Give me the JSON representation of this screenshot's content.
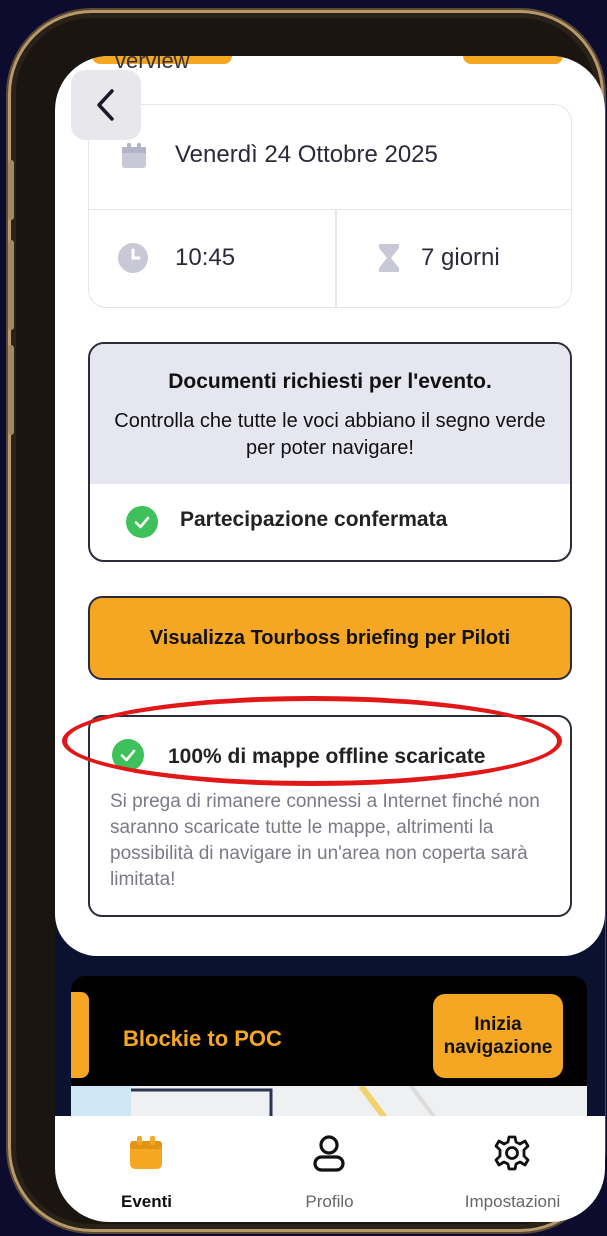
{
  "header": {
    "peek_text": "verview"
  },
  "event_info": {
    "date": "Venerdì 24 Ottobre 2025",
    "time": "10:45",
    "duration": "7 giorni"
  },
  "documents": {
    "title": "Documenti richiesti per l'evento.",
    "subtitle": "Controlla che tutte le voci abbiano il segno verde per poter navigare!",
    "items": [
      {
        "label": "Partecipazione confermata",
        "status": "check-icon"
      }
    ]
  },
  "briefing_button": {
    "label": "Visualizza Tourboss briefing per Piloti"
  },
  "offline_maps": {
    "title": "100% di mappe offline scaricate",
    "description": "Si prega di rimanere connessi a Internet finché non saranno scaricate tutte le mappe, altrimenti la possibilità di navigare in un'area non coperta sarà limitata!"
  },
  "event_bar": {
    "name": "Blockie to POC",
    "start_button": "Inizia navigazione"
  },
  "tabbar": {
    "tabs": [
      {
        "label": "Eventi",
        "icon": "calendar-icon",
        "active": true
      },
      {
        "label": "Profilo",
        "icon": "user-icon",
        "active": false
      },
      {
        "label": "Impostazioni",
        "icon": "gear-icon",
        "active": false
      }
    ]
  },
  "colors": {
    "accent": "#f5a623",
    "success": "#3ec15a",
    "annotation": "#e21818",
    "background": "#0d0b2e"
  }
}
